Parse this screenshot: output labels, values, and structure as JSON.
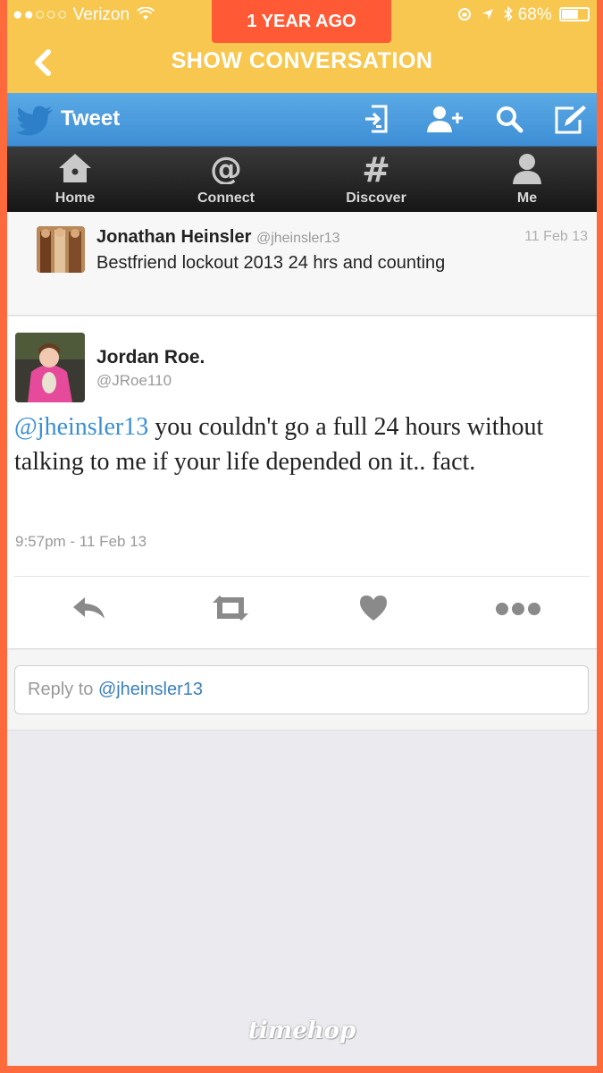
{
  "status_bar": {
    "signal_dots": "●●○○○",
    "carrier": "Verizon",
    "battery": "68%"
  },
  "timehop_tag": "1 YEAR AGO",
  "nav": {
    "back_icon": "chevron-left-icon",
    "title": "SHOW CONVERSATION"
  },
  "tweet_bar": {
    "title": "Tweet",
    "icons": [
      "twitter-bird-icon",
      "sign-in-icon",
      "add-user-icon",
      "search-icon",
      "compose-icon"
    ]
  },
  "tabs": [
    {
      "label": "Home",
      "icon": "house-icon"
    },
    {
      "label": "Connect",
      "icon": "at-icon"
    },
    {
      "label": "Discover",
      "icon": "hash-icon"
    },
    {
      "label": "Me",
      "icon": "person-icon"
    }
  ],
  "previous_tweet": {
    "name": "Jonathan Heinsler",
    "handle": "@jheinsler13",
    "date": "11 Feb 13",
    "text": "Bestfriend lockout 2013 24 hrs and counting"
  },
  "main_tweet": {
    "name": "Jordan Roe.",
    "handle": "@JRoe110",
    "mention": "@jheinsler13",
    "text": " you couldn't go a full 24 hours without talking to me if your life depended on it.. fact.",
    "time": "9:57pm - 11 Feb 13",
    "actions": [
      "reply-icon",
      "retweet-icon",
      "favorite-icon",
      "more-icon"
    ]
  },
  "reply": {
    "prefix": "Reply to ",
    "mention": "@jheinsler13"
  },
  "watermark": "timehop",
  "colors": {
    "frame": "#ff6a3c",
    "yellow": "#f8c74f",
    "twitter_blue": "#3e8ed6",
    "mention": "#3a8fd3"
  }
}
